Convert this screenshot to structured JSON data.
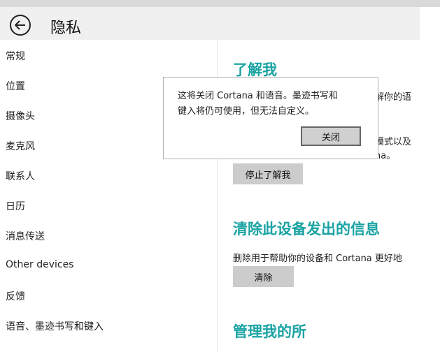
{
  "header": {
    "title": "隐私"
  },
  "sidebar": {
    "items": [
      {
        "label": "常规"
      },
      {
        "label": "位置"
      },
      {
        "label": "摄像头"
      },
      {
        "label": "麦克风"
      },
      {
        "label": "联系人"
      },
      {
        "label": "日历"
      },
      {
        "label": "消息传送"
      },
      {
        "label": "Other devices"
      },
      {
        "label": "反馈"
      },
      {
        "label": "语音、墨迹书写和键入"
      }
    ]
  },
  "main": {
    "know_me": {
      "heading": "了解我",
      "text_fragment_1": "解你的语",
      "text_fragment_2": "模式以及",
      "text_fragment_3": "na。",
      "stop_button": "停止了解我"
    },
    "clear_section": {
      "heading": "清除此设备发出的信息",
      "description": "删除用于帮助你的设备和 Cortana 更好地",
      "clear_button": "清除"
    },
    "manage_section": {
      "heading": "管理我的所"
    }
  },
  "dialog": {
    "line1": "这将关闭 Cortana 和语音。墨迹书写和",
    "line2": "键入将仍可使用，但无法自定义。",
    "close_button": "关闭"
  },
  "colors": {
    "accent": "#1aa3a3",
    "button_bg": "#cccccc",
    "titlebar_bg": "#f0f0f0"
  }
}
